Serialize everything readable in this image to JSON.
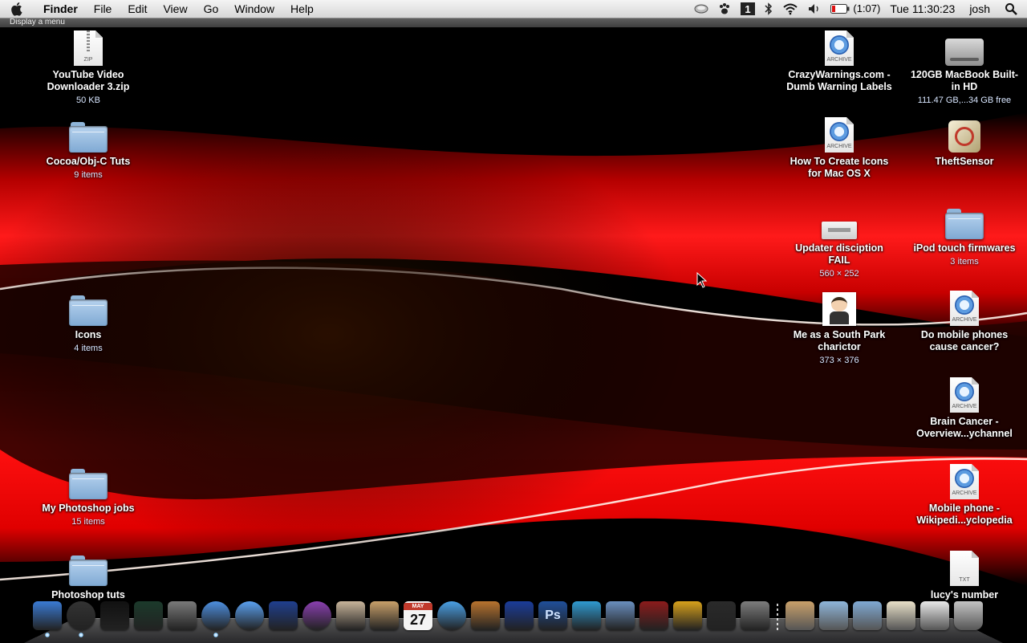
{
  "menubar": {
    "apple_icon": "apple-logo",
    "app_name": "Finder",
    "menus": [
      "File",
      "Edit",
      "View",
      "Go",
      "Window",
      "Help"
    ],
    "status": {
      "battery_time": "(1:07)",
      "clock": "Tue 11:30:23",
      "user": "josh"
    },
    "status_icons": [
      "time-machine-icon",
      "paw-icon",
      "spaces-icon",
      "bluetooth-icon",
      "wifi-icon",
      "volume-icon",
      "battery-icon",
      "spotlight-icon"
    ],
    "spaces_number": "1"
  },
  "helpbar": {
    "text": "Display a menu"
  },
  "desktop_left": [
    {
      "label": "YouTube Video Downloader 3.zip",
      "sub": "50 KB",
      "kind": "zip",
      "tag": "ZIP"
    },
    {
      "label": "Cocoa/Obj-C Tuts",
      "sub": "9 items",
      "kind": "folder"
    },
    {
      "label": "Icons",
      "sub": "4 items",
      "kind": "folder"
    },
    {
      "label": "My Photoshop jobs",
      "sub": "15 items",
      "kind": "folder"
    },
    {
      "label": "Photoshop tuts",
      "sub": "",
      "kind": "folder"
    }
  ],
  "desktop_right_col1": [
    {
      "label": "CrazyWarnings.com - Dumb Warning Labels",
      "sub": "",
      "kind": "archive",
      "tag": "ARCHIVE"
    },
    {
      "label": "How To Create Icons for Mac OS X",
      "sub": "",
      "kind": "archive",
      "tag": "ARCHIVE"
    },
    {
      "label": "Updater disciption FAIL",
      "sub": "560 × 252",
      "kind": "image-wide"
    },
    {
      "label": "Me as a South Park charictor",
      "sub": "373 × 376",
      "kind": "image-sq"
    }
  ],
  "desktop_right_col2": [
    {
      "label": "120GB MacBook Built-in HD",
      "sub": "111.47 GB,...34 GB free",
      "kind": "hd"
    },
    {
      "label": "TheftSensor",
      "sub": "",
      "kind": "app"
    },
    {
      "label": "iPod touch firmwares",
      "sub": "3 items",
      "kind": "folder"
    },
    {
      "label": "Do mobile phones cause cancer?",
      "sub": "",
      "kind": "archive",
      "tag": "ARCHIVE"
    },
    {
      "label": "Brain Cancer - Overview...ychannel",
      "sub": "",
      "kind": "archive",
      "tag": "ARCHIVE"
    },
    {
      "label": "Mobile phone - Wikipedi...yclopedia",
      "sub": "",
      "kind": "archive",
      "tag": "ARCHIVE"
    },
    {
      "label": "lucy's number",
      "sub": "",
      "kind": "txt",
      "tag": "TXT"
    }
  ],
  "dock": {
    "calendar_month": "MAY",
    "calendar_day": "27",
    "photoshop_label": "Ps",
    "items": [
      {
        "name": "finder-icon",
        "color": "#3a7bd5",
        "running": true
      },
      {
        "name": "dashboard-icon",
        "color": "#333333",
        "running": true
      },
      {
        "name": "terminal-icon",
        "color": "#111111",
        "running": false
      },
      {
        "name": "activity-monitor-icon",
        "color": "#1b3a2b",
        "running": false
      },
      {
        "name": "automator-icon",
        "color": "#7a7a7a",
        "running": false
      },
      {
        "name": "safari-icon",
        "color": "#4d8fe0",
        "running": true
      },
      {
        "name": "ichat-icon",
        "color": "#5aa0f0",
        "running": false
      },
      {
        "name": "tardis-icon",
        "color": "#1f3f8f",
        "running": false
      },
      {
        "name": "firefox-icon",
        "color": "#8a3fb0",
        "running": false
      },
      {
        "name": "mail-icon",
        "color": "#c8b49a",
        "running": false
      },
      {
        "name": "address-book-icon",
        "color": "#c9a06a",
        "running": false
      },
      {
        "name": "ical-icon",
        "color": "#f1f1f1",
        "running": false
      },
      {
        "name": "itunes-icon",
        "color": "#4aa0e6",
        "running": false
      },
      {
        "name": "garageband-icon",
        "color": "#b8732e",
        "running": false
      },
      {
        "name": "audacity-icon",
        "color": "#1a3c9a",
        "running": false
      },
      {
        "name": "photoshop-icon",
        "color": "#1f4f9a",
        "running": false
      },
      {
        "name": "fish-icon",
        "color": "#2f9ad1",
        "running": false
      },
      {
        "name": "iphoto-icon",
        "color": "#6a8fbf",
        "running": false
      },
      {
        "name": "movie-icon",
        "color": "#8b1b1b",
        "running": false
      },
      {
        "name": "imovie-icon",
        "color": "#d8a11b",
        "running": false
      },
      {
        "name": "final-cut-icon",
        "color": "#2a2a2a",
        "running": false
      },
      {
        "name": "system-preferences-icon",
        "color": "#7d7d7d",
        "running": false
      }
    ],
    "stack_items": [
      {
        "name": "address-book-stack-icon",
        "color": "#c9a06a"
      },
      {
        "name": "folder-stack-icon",
        "color": "#8fb6da"
      },
      {
        "name": "documents-stack-icon",
        "color": "#7fa9d3"
      },
      {
        "name": "paint-palette-icon",
        "color": "#e8e0c8"
      },
      {
        "name": "zip-stack-icon",
        "color": "#e8e8e8"
      },
      {
        "name": "trash-icon",
        "color": "#c4c4c4"
      }
    ]
  }
}
